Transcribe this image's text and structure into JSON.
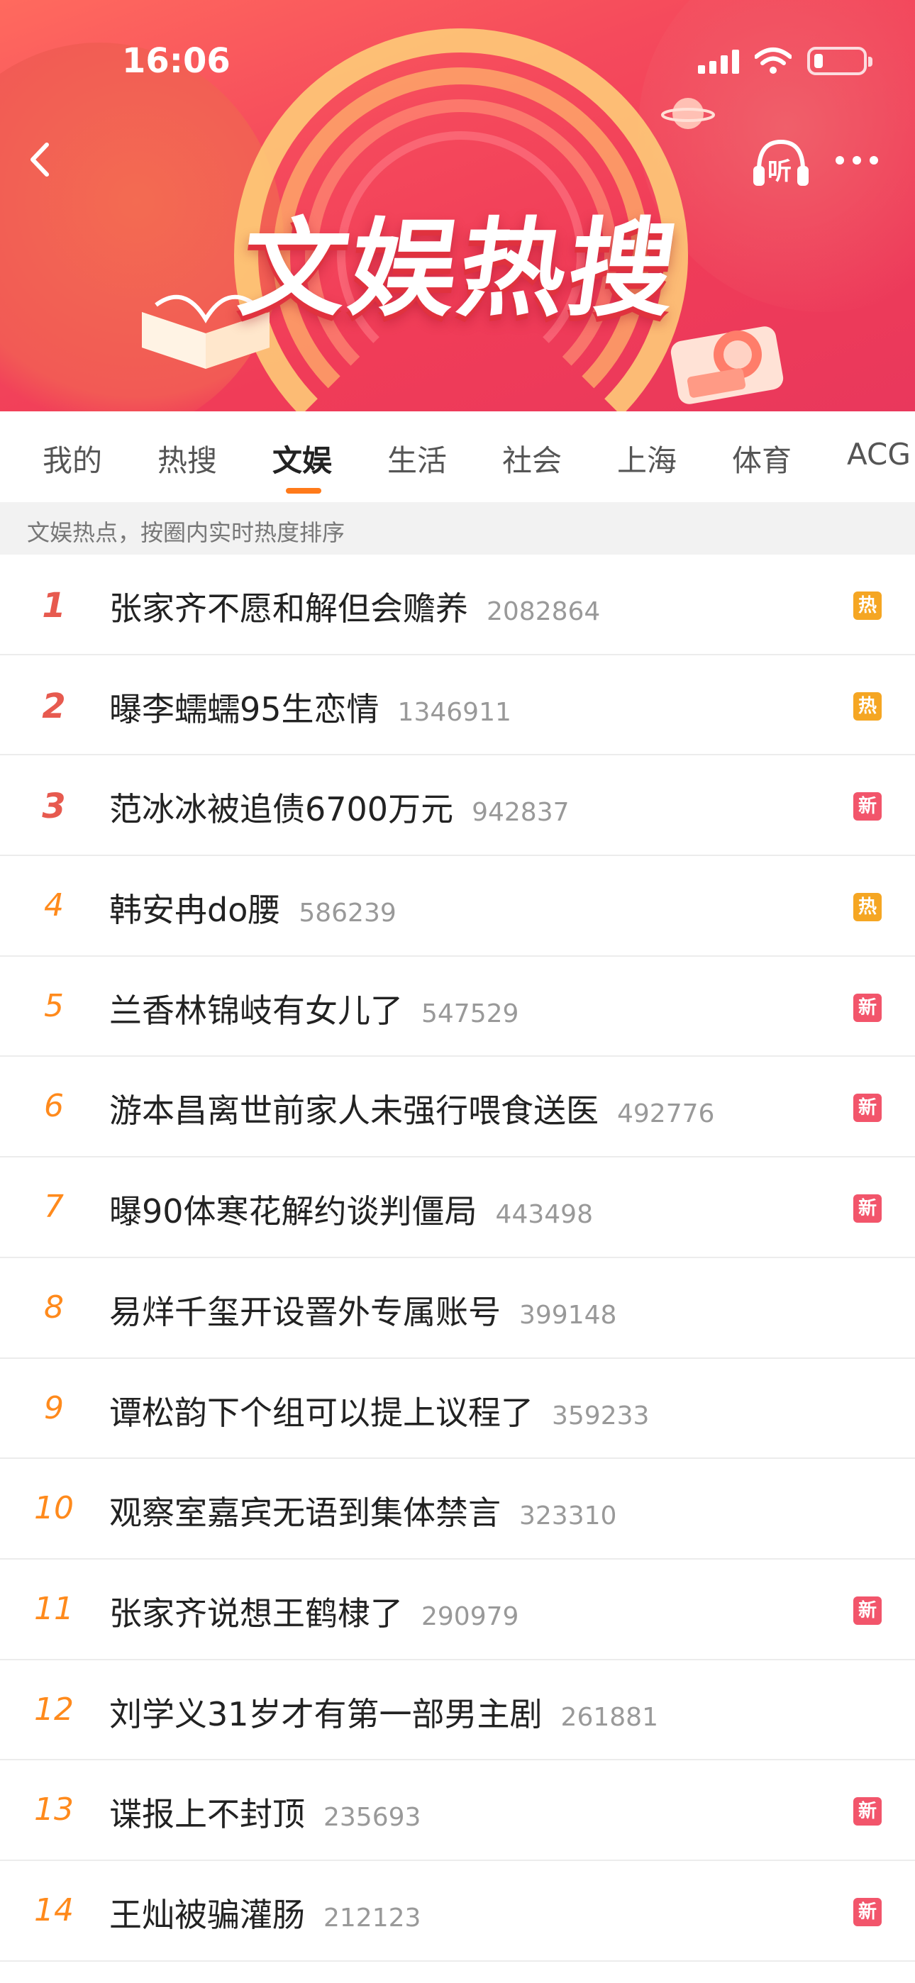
{
  "status_bar": {
    "time": "16:06"
  },
  "header": {
    "title": "文娱热搜",
    "listen_label": "听"
  },
  "tabs": [
    {
      "label": "我的"
    },
    {
      "label": "热搜"
    },
    {
      "label": "文娱",
      "active": true
    },
    {
      "label": "生活"
    },
    {
      "label": "社会"
    },
    {
      "label": "上海"
    },
    {
      "label": "体育"
    },
    {
      "label": "ACG"
    }
  ],
  "subheader": "文娱热点，按圈内实时热度排序",
  "badge_labels": {
    "hot": "热",
    "new": "新"
  },
  "colors": {
    "hot_badge": "#f5a623",
    "new_badge": "#f2556b",
    "rank": "#ff8a1c",
    "tab_indicator": "#ff7a1a"
  },
  "items": [
    {
      "rank": "1",
      "title": "张家齐不愿和解但会赡养",
      "count": "2082864",
      "badge": "热"
    },
    {
      "rank": "2",
      "title": "曝李蠕蠕95生恋情",
      "count": "1346911",
      "badge": "热"
    },
    {
      "rank": "3",
      "title": "范冰冰被追债6700万元",
      "count": "942837",
      "badge": "新"
    },
    {
      "rank": "4",
      "title": "韩安冉do腰",
      "count": "586239",
      "badge": "热"
    },
    {
      "rank": "5",
      "title": "兰香林锦岐有女儿了",
      "count": "547529",
      "badge": "新"
    },
    {
      "rank": "6",
      "title": "游本昌离世前家人未强行喂食送医",
      "count": "492776",
      "badge": "新"
    },
    {
      "rank": "7",
      "title": "曝90体寒花解约谈判僵局",
      "count": "443498",
      "badge": "新"
    },
    {
      "rank": "8",
      "title": "易烊千玺开设罯外专属账号",
      "count": "399148",
      "badge": ""
    },
    {
      "rank": "9",
      "title": "谭松韵下个组可以提上议程了",
      "count": "359233",
      "badge": ""
    },
    {
      "rank": "10",
      "title": "观察室嘉宾无语到集体禁言",
      "count": "323310",
      "badge": ""
    },
    {
      "rank": "11",
      "title": "张家齐说想王鹤棣了",
      "count": "290979",
      "badge": "新"
    },
    {
      "rank": "12",
      "title": "刘学义31岁才有第一部男主剧",
      "count": "261881",
      "badge": ""
    },
    {
      "rank": "13",
      "title": "谍报上不封顶",
      "count": "235693",
      "badge": "新"
    },
    {
      "rank": "14",
      "title": "王灿被骗灌肠",
      "count": "212123",
      "badge": "新"
    }
  ]
}
